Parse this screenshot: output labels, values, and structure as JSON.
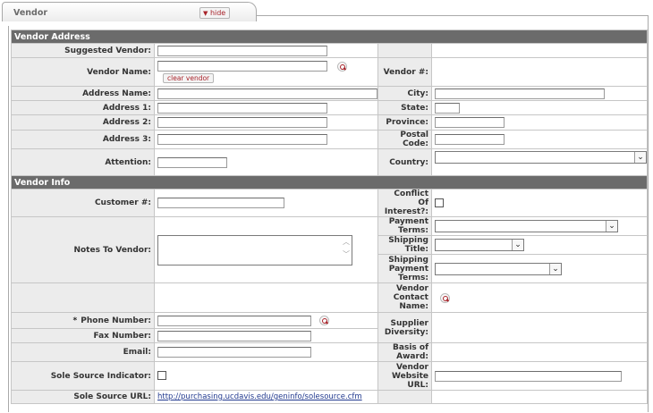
{
  "tab": {
    "title": "Vendor",
    "hide_label": "hide"
  },
  "sections": {
    "vendor_address": "Vendor Address",
    "vendor_info": "Vendor Info"
  },
  "labels": {
    "suggested_vendor": "Suggested Vendor:",
    "vendor_name": "Vendor Name:",
    "vendor_number": "Vendor #:",
    "address_name": "Address Name:",
    "city": "City:",
    "address_1": "Address 1:",
    "state": "State:",
    "address_2": "Address 2:",
    "province": "Province:",
    "address_3": "Address 3:",
    "postal_code": "Postal Code:",
    "attention": "Attention:",
    "country": "Country:",
    "customer_number": "Customer #:",
    "conflict_of_interest": "Conflict Of Interest?:",
    "notes_to_vendor": "Notes To Vendor:",
    "payment_terms": "Payment Terms:",
    "shipping_title": "Shipping Title:",
    "shipping_payment_terms": "Shipping Payment Terms:",
    "vendor_contact_name": "Vendor Contact Name:",
    "phone_required_marker": "*",
    "phone_number": "Phone Number:",
    "supplier_diversity": "Supplier Diversity:",
    "fax_number": "Fax Number:",
    "email": "Email:",
    "basis_of_award": "Basis of Award:",
    "sole_source_indicator": "Sole Source Indicator:",
    "vendor_website_url": "Vendor Website URL:",
    "sole_source_url": "Sole Source URL:"
  },
  "buttons": {
    "clear_vendor": "clear vendor"
  },
  "values": {
    "suggested_vendor": "",
    "vendor_name": "",
    "vendor_number": "",
    "address_name": "",
    "city": "",
    "address_1": "",
    "state": "",
    "address_2": "",
    "province": "",
    "address_3": "",
    "postal_code": "",
    "attention": "",
    "country": "",
    "customer_number": "",
    "notes_to_vendor": "",
    "payment_terms": "",
    "shipping_title": "",
    "shipping_payment_terms": "",
    "phone_number": "",
    "fax_number": "",
    "email": "",
    "vendor_website_url": "",
    "sole_source_url": "http://purchasing.ucdavis.edu/geninfo/solesource.cfm"
  },
  "icons": {
    "lookup": "magnifier-lookup-icon",
    "hide": "triangle-down-icon",
    "dropdown": "chevron-down-icon"
  },
  "colors": {
    "section_header": "#6b6b6b",
    "label_cell": "#ececec",
    "accent_red": "#a8232a",
    "link": "#223a8f"
  }
}
